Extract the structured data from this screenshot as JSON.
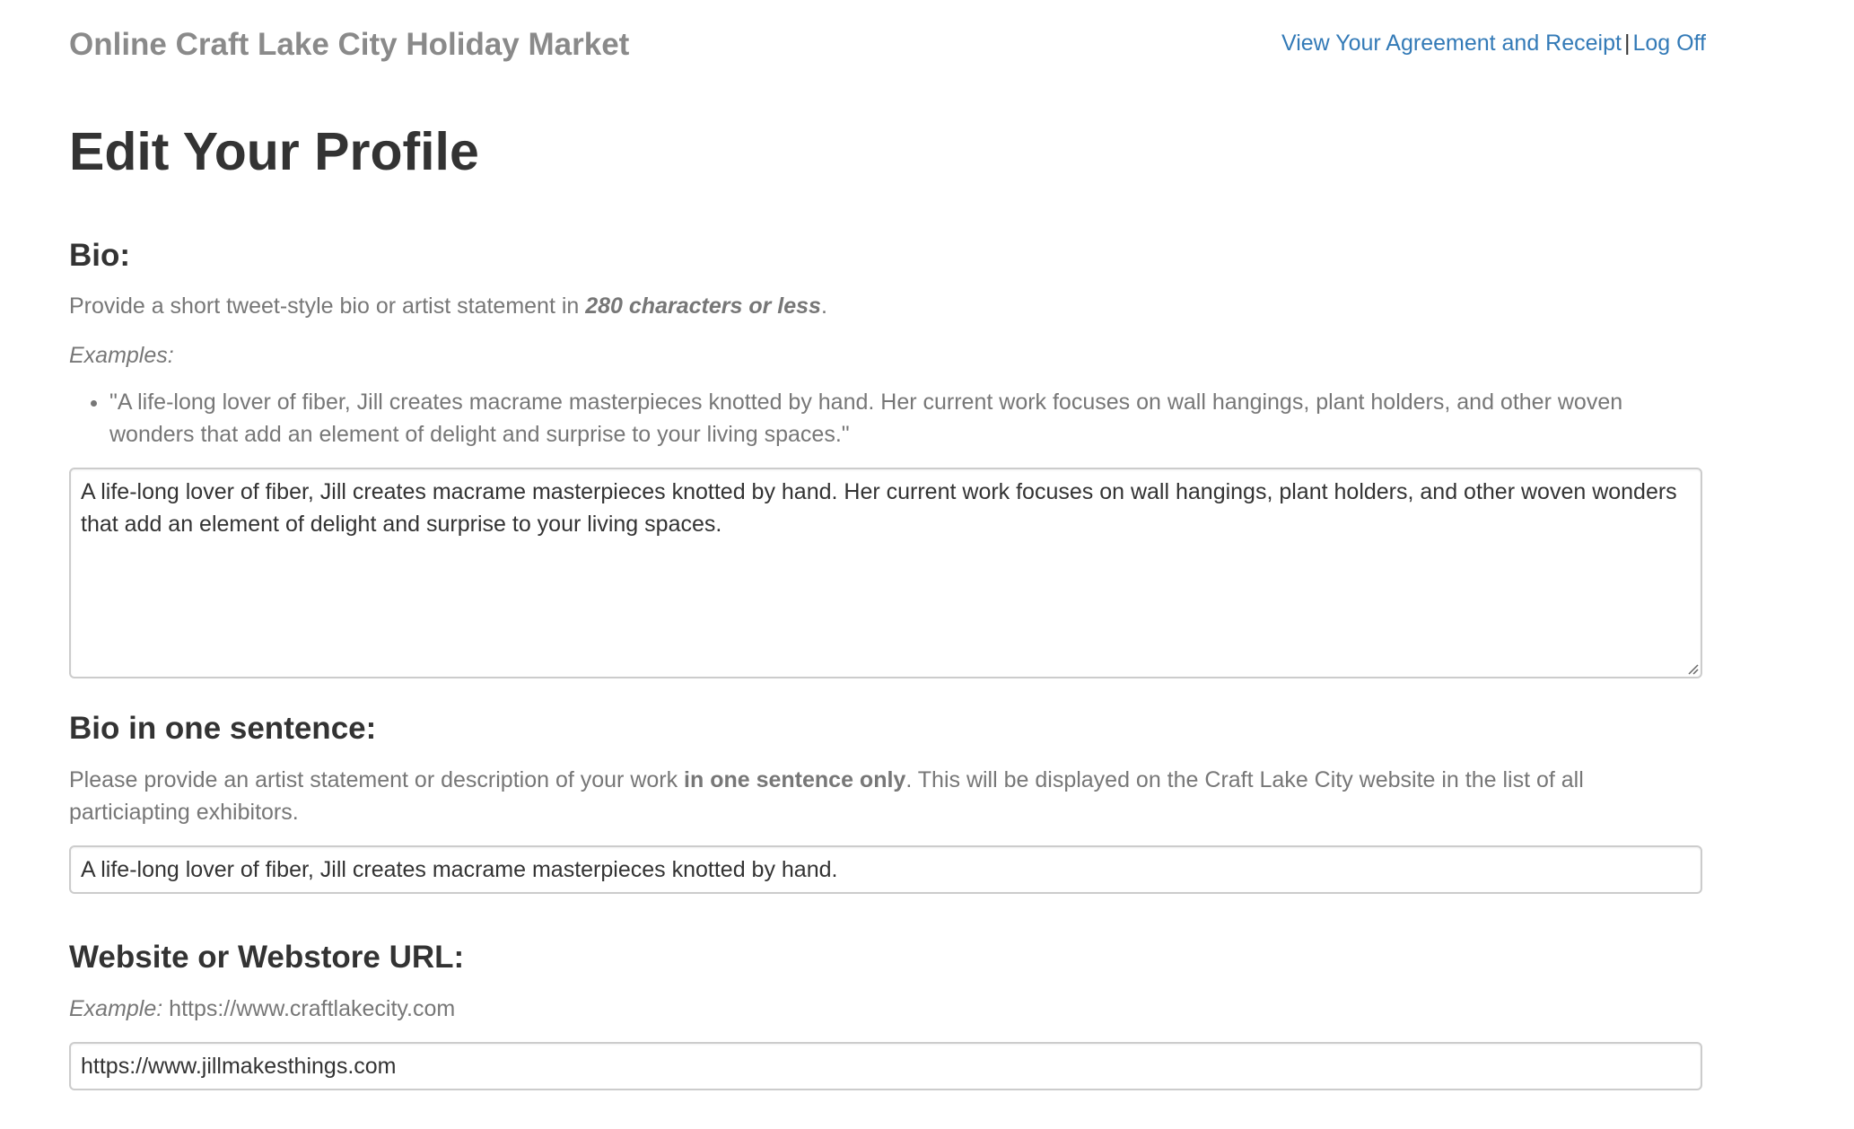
{
  "header": {
    "brand": "Online Craft Lake City Holiday Market",
    "nav": {
      "agreement_link": "View Your Agreement and Receipt",
      "separator": "|",
      "logoff_link": "Log Off"
    }
  },
  "page_title": "Edit Your Profile",
  "bio": {
    "heading": "Bio:",
    "help_prefix": "Provide a short tweet-style bio or artist statement in ",
    "help_emphasis": "280 characters or less",
    "help_suffix": ".",
    "examples_label": "Examples:",
    "examples": [
      "\"A life-long lover of fiber, Jill creates macrame masterpieces knotted by hand. Her current work focuses on wall hangings, plant holders, and other woven wonders that add an element of delight and surprise to your living spaces.\""
    ],
    "value": "A life-long lover of fiber, Jill creates macrame masterpieces knotted by hand. Her current work focuses on wall hangings, plant holders, and other woven wonders that add an element of delight and surprise to your living spaces."
  },
  "bio_sentence": {
    "heading": "Bio in one sentence:",
    "help_prefix": "Please provide an artist statement or description of your work ",
    "help_bold": "in one sentence only",
    "help_suffix": ". This will be displayed on the Craft Lake City website in the list of all particiapting exhibitors.",
    "value": "A life-long lover of fiber, Jill creates macrame masterpieces knotted by hand."
  },
  "website": {
    "heading": "Website or Webstore URL:",
    "example_label": "Example:",
    "example_url": " https://www.craftlakecity.com",
    "value": "https://www.jillmakesthings.com"
  },
  "colors": {
    "link": "#337ab7",
    "heading": "#333333",
    "muted": "#777777",
    "brand": "#8a8a8a",
    "border": "#cccccc"
  }
}
